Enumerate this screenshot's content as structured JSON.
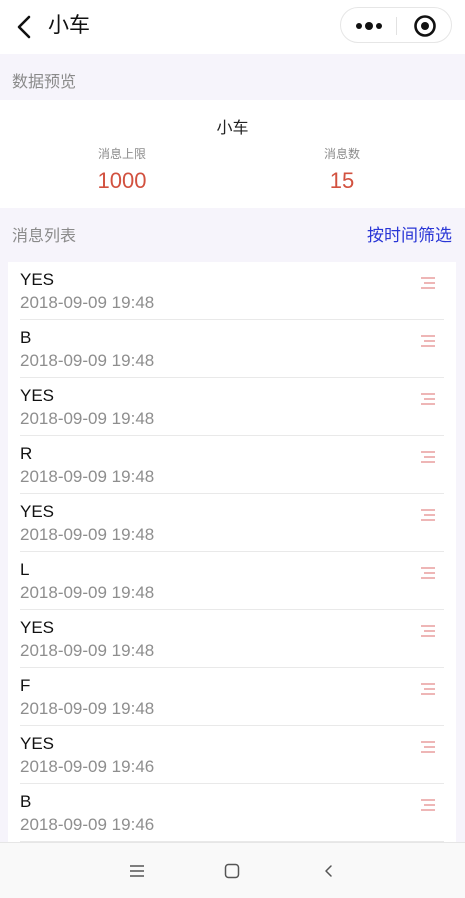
{
  "header": {
    "title": "小车"
  },
  "sections": {
    "data_preview_label": "数据预览",
    "message_list_label": "消息列表",
    "filter_label": "按时间筛选"
  },
  "preview": {
    "device_name": "小车",
    "limit_label": "消息上限",
    "limit_value": "1000",
    "count_label": "消息数",
    "count_value": "15"
  },
  "messages": [
    {
      "content": "YES",
      "time": "2018-09-09 19:48"
    },
    {
      "content": "B",
      "time": "2018-09-09 19:48"
    },
    {
      "content": "YES",
      "time": "2018-09-09 19:48"
    },
    {
      "content": "R",
      "time": "2018-09-09 19:48"
    },
    {
      "content": "YES",
      "time": "2018-09-09 19:48"
    },
    {
      "content": "L",
      "time": "2018-09-09 19:48"
    },
    {
      "content": "YES",
      "time": "2018-09-09 19:48"
    },
    {
      "content": "F",
      "time": "2018-09-09 19:48"
    },
    {
      "content": "YES",
      "time": "2018-09-09 19:46"
    },
    {
      "content": "B",
      "time": "2018-09-09 19:46"
    }
  ],
  "colors": {
    "accent_link": "#2a36d6",
    "stat_value": "#d2513f",
    "item_icon": "#e07a7a"
  },
  "icons": {
    "back": "chevron-left-icon",
    "more": "more-dots-icon",
    "close": "target-circle-icon",
    "item_menu": "list-lines-icon",
    "nav_menu": "hamburger-icon",
    "nav_home": "square-icon",
    "nav_back": "chevron-left-icon"
  }
}
